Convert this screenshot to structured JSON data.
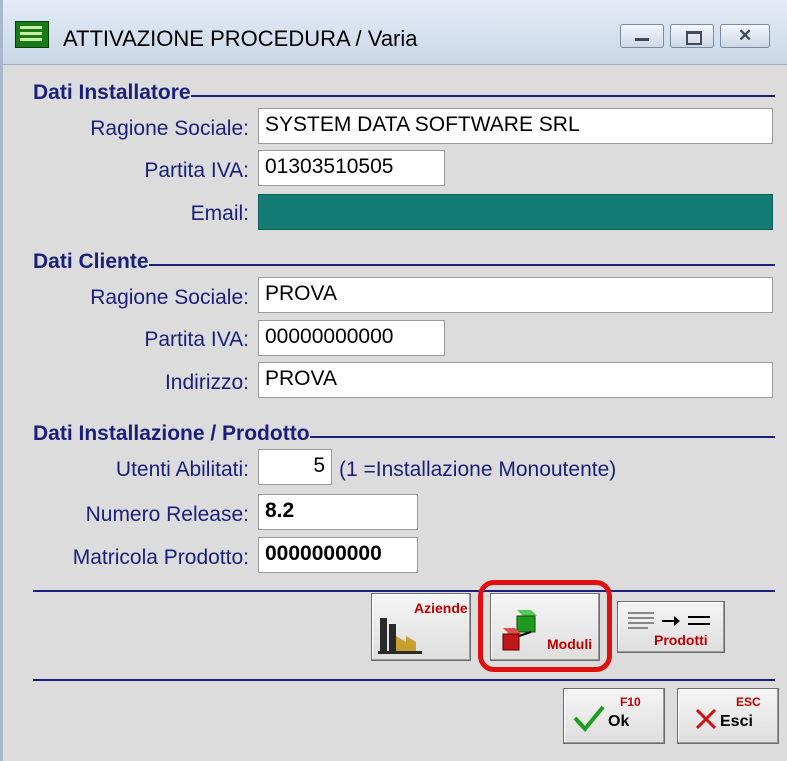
{
  "window": {
    "title": "ATTIVAZIONE PROCEDURA / Varia"
  },
  "installatore": {
    "section_title": "Dati Installatore",
    "ragione_sociale_label": "Ragione Sociale:",
    "ragione_sociale_value": "SYSTEM DATA SOFTWARE SRL",
    "partita_iva_label": "Partita IVA:",
    "partita_iva_value": "01303510505",
    "email_label": "Email:",
    "email_value": ""
  },
  "cliente": {
    "section_title": "Dati Cliente",
    "ragione_sociale_label": "Ragione Sociale:",
    "ragione_sociale_value": "PROVA",
    "partita_iva_label": "Partita IVA:",
    "partita_iva_value": "00000000000",
    "indirizzo_label": "Indirizzo:",
    "indirizzo_value": "PROVA"
  },
  "installazione": {
    "section_title": "Dati Installazione / Prodotto",
    "utenti_label": "Utenti Abilitati:",
    "utenti_value": "5",
    "utenti_hint": "(1 =Installazione Monoutente)",
    "release_label": "Numero Release:",
    "release_value": "8.2",
    "matricola_label": "Matricola Prodotto:",
    "matricola_value": "0000000000"
  },
  "toolbar": {
    "aziende_label": "Aziende",
    "moduli_label": "Moduli",
    "prodotti_label": "Prodotti"
  },
  "actions": {
    "ok_key": "F10",
    "ok_label": "Ok",
    "esci_key": "ESC",
    "esci_label": "Esci"
  },
  "colors": {
    "accent": "#1a1f7a",
    "email_fill": "#137c74",
    "highlight": "#e01010"
  }
}
